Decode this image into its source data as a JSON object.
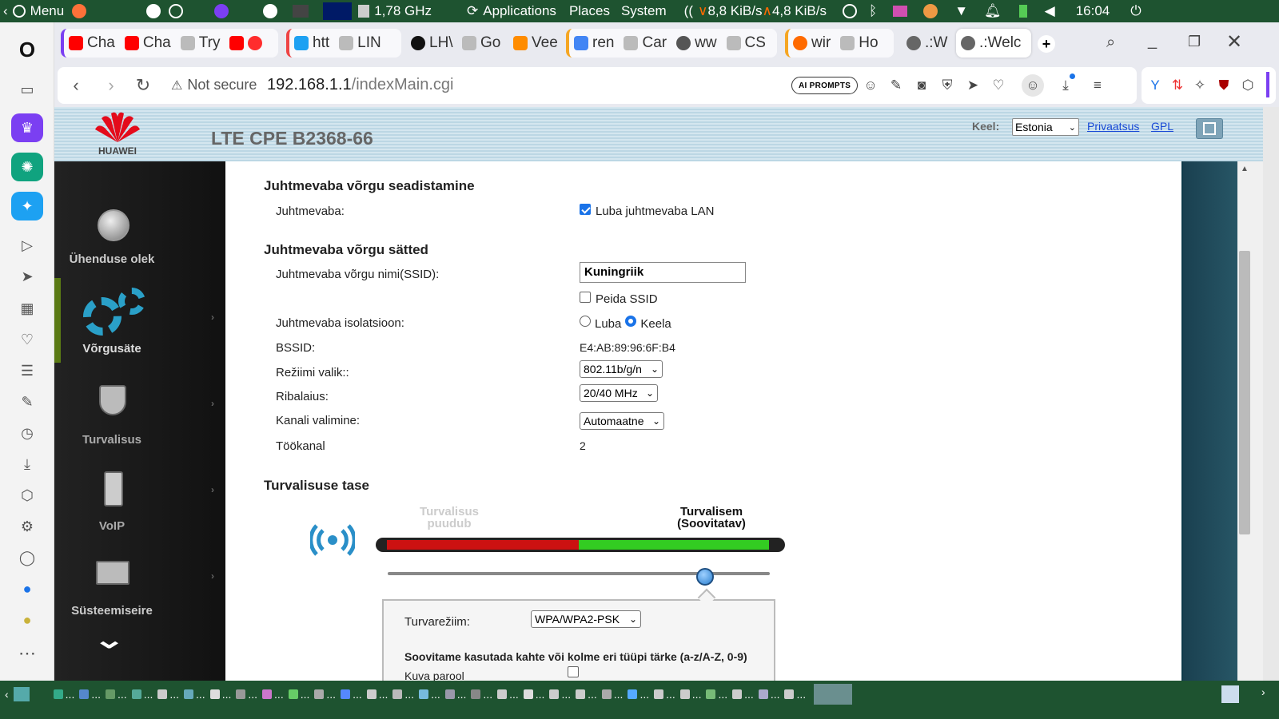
{
  "top_panel": {
    "menu_label": "Menu",
    "cpu_freq": "1,78 GHz",
    "applications": "Applications",
    "places": "Places",
    "system": "System",
    "net_down": "8,8 KiB/s",
    "net_up": "4,8 KiB/s",
    "clock": "16:04"
  },
  "tabs": [
    {
      "label": "Cha",
      "color": "#ff0000"
    },
    {
      "label": "Cha",
      "color": "#ff0000"
    },
    {
      "label": "Try",
      "color": "#888888"
    },
    {
      "label": "",
      "color": "#ff0000"
    },
    {
      "label": "htt",
      "color": "#1da1f2"
    },
    {
      "label": "LIN",
      "color": "#888888"
    },
    {
      "label": "LH\\",
      "color": "#111111"
    },
    {
      "label": "Go",
      "color": "#888888"
    },
    {
      "label": "Vee",
      "color": "#ff8c00"
    },
    {
      "label": "ren",
      "color": "#4285f4"
    },
    {
      "label": "Car",
      "color": "#888888"
    },
    {
      "label": "ww",
      "color": "#555555"
    },
    {
      "label": "CS",
      "color": "#888888"
    },
    {
      "label": "wir",
      "color": "#ff6a00"
    },
    {
      "label": "Ho",
      "color": "#888888"
    },
    {
      "label": ".:W",
      "color": "#555555"
    },
    {
      "label": ".:Welc",
      "color": "#555555"
    }
  ],
  "address_bar": {
    "security_label": "Not secure",
    "url_host": "192.168.1.1",
    "url_path": "/indexMain.cgi",
    "ai_prompts": "AI PROMPTS"
  },
  "router": {
    "logo_text": "HUAWEI",
    "product_title": "LTE CPE B2368-66",
    "language_label": "Keel:",
    "language_value": "Estonia",
    "privacy_link": "Privaatsus",
    "gpl_link": "GPL",
    "nav": [
      {
        "label": "Ühenduse olek",
        "icon": "globe-icon"
      },
      {
        "label": "Võrgusäte",
        "icon": "gears-icon"
      },
      {
        "label": "Turvalisus",
        "icon": "shield-icon"
      },
      {
        "label": "VoIP",
        "icon": "phone-icon"
      },
      {
        "label": "Süsteemiseire",
        "icon": "monitor-icon"
      }
    ],
    "wireless_setup": {
      "title": "Juhtmevaba võrgu seadistamine",
      "enable_label": "Juhtmevaba:",
      "enable_checkbox_label": "Luba juhtmevaba LAN",
      "enabled": true
    },
    "wireless_settings": {
      "title": "Juhtmevaba võrgu sätted",
      "ssid_label": "Juhtmevaba võrgu nimi(SSID):",
      "ssid_value": "Kuningriik",
      "hide_ssid_label": "Peida SSID",
      "hide_ssid": false,
      "isolation_label": "Juhtmevaba isolatsioon:",
      "isolation_option_enable": "Luba",
      "isolation_option_disable": "Keela",
      "isolation_selected": "Keela",
      "bssid_label": "BSSID:",
      "bssid_value": "E4:AB:89:96:6F:B4",
      "mode_label": "Režiimi valik::",
      "mode_value": "802.11b/g/n",
      "bandwidth_label": "Ribalaius:",
      "bandwidth_value": "20/40 MHz",
      "channel_select_label": "Kanali valimine:",
      "channel_select_value": "Automaatne",
      "work_channel_label": "Töökanal",
      "work_channel_value": "2"
    },
    "security_level": {
      "title": "Turvalisuse tase",
      "low_label_1": "Turvalisus",
      "low_label_2": "puudub",
      "high_label_1": "Turvalisem",
      "high_label_2": "(Soovitatav)",
      "slider_fraction": 0.83,
      "mode_label": "Turvarežiim:",
      "mode_value": "WPA/WPA2-PSK",
      "password_hint": "Soovitame kasutada kahte või kolme eri tüüpi tärke (a-z/A-Z, 0-9)",
      "show_password_label": "Kuva parool",
      "show_password": false
    }
  },
  "colors": {
    "panel_green": "#1e5330",
    "accent_blue": "#1a73e8",
    "bar_red": "#cc1111",
    "bar_green": "#33cc22",
    "link_blue": "#1a4ad6"
  }
}
